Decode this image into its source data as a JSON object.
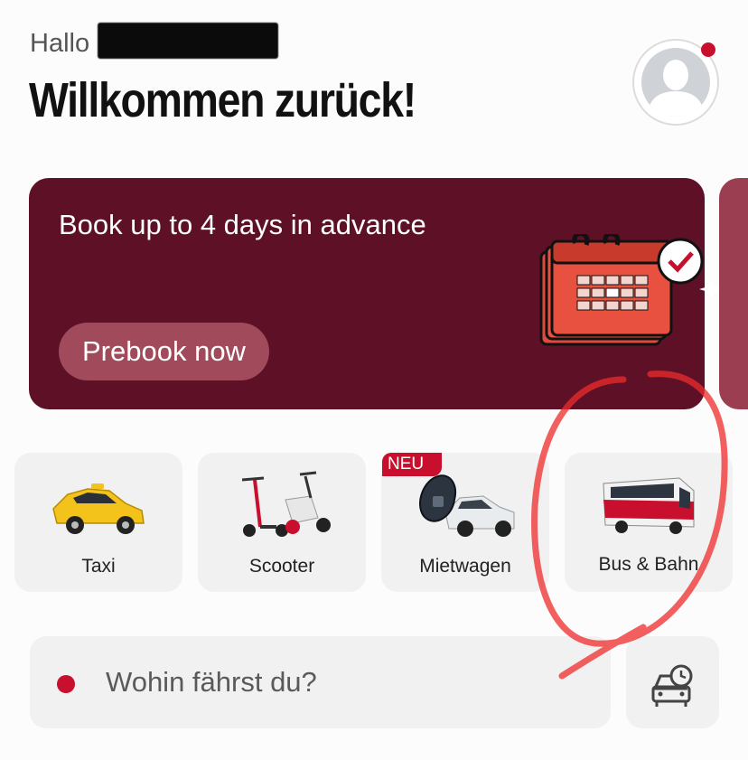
{
  "header": {
    "greeting": "Hallo",
    "title": "Willkommen zurück!"
  },
  "banner": {
    "title": "Book up to 4 days in advance",
    "button_label": "Prebook now"
  },
  "services": [
    {
      "label": "Taxi",
      "icon": "taxi-icon"
    },
    {
      "label": "Scooter",
      "icon": "scooter-icon"
    },
    {
      "label": "Mietwagen",
      "icon": "rental-car-icon",
      "badge": "NEU"
    },
    {
      "label": "Bus & Bahn",
      "icon": "bus-icon"
    }
  ],
  "search": {
    "placeholder": "Wohin fährst du?"
  },
  "colors": {
    "accent": "#c8102e",
    "banner": "#5e1126",
    "button": "#a14a5c"
  }
}
